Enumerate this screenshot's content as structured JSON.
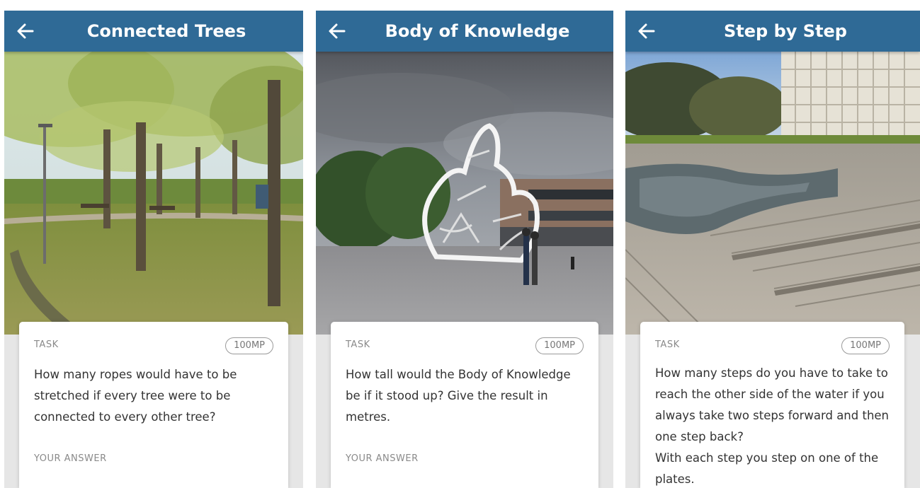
{
  "screens": [
    {
      "title": "Connected Trees",
      "photo": "photo of trees in a park",
      "task_label": "TASK",
      "points": "100MP",
      "question": "How many ropes would have to be stretched if every tree were to be connected to every other tree?",
      "answer_label": "YOUR ANSWER"
    },
    {
      "title": "Body of Knowledge",
      "photo": "photo of a white letter sculpture of a seated figure",
      "task_label": "TASK",
      "points": "100MP",
      "question": "How tall would the Body of Knowledge be if it stood up? Give the result in metres.",
      "answer_label": "YOUR ANSWER"
    },
    {
      "title": "Step by Step",
      "photo": "photo of stone steps beside a water basin",
      "task_label": "TASK",
      "points": "100MP",
      "question": "How many steps do you have to take to reach the other side of the water if you always take two steps forward and then one step back?\nWith each step you step on one of the plates.",
      "answer_label": ""
    }
  ],
  "colors": {
    "app_bar": "#2f6a96",
    "app_bar_text": "#ffffff",
    "screen_background": "#e6e6e6",
    "card": "#ffffff",
    "label_text": "#8a8a8a",
    "question_text": "#333333"
  },
  "icons": {
    "back": "arrow-left-icon"
  }
}
